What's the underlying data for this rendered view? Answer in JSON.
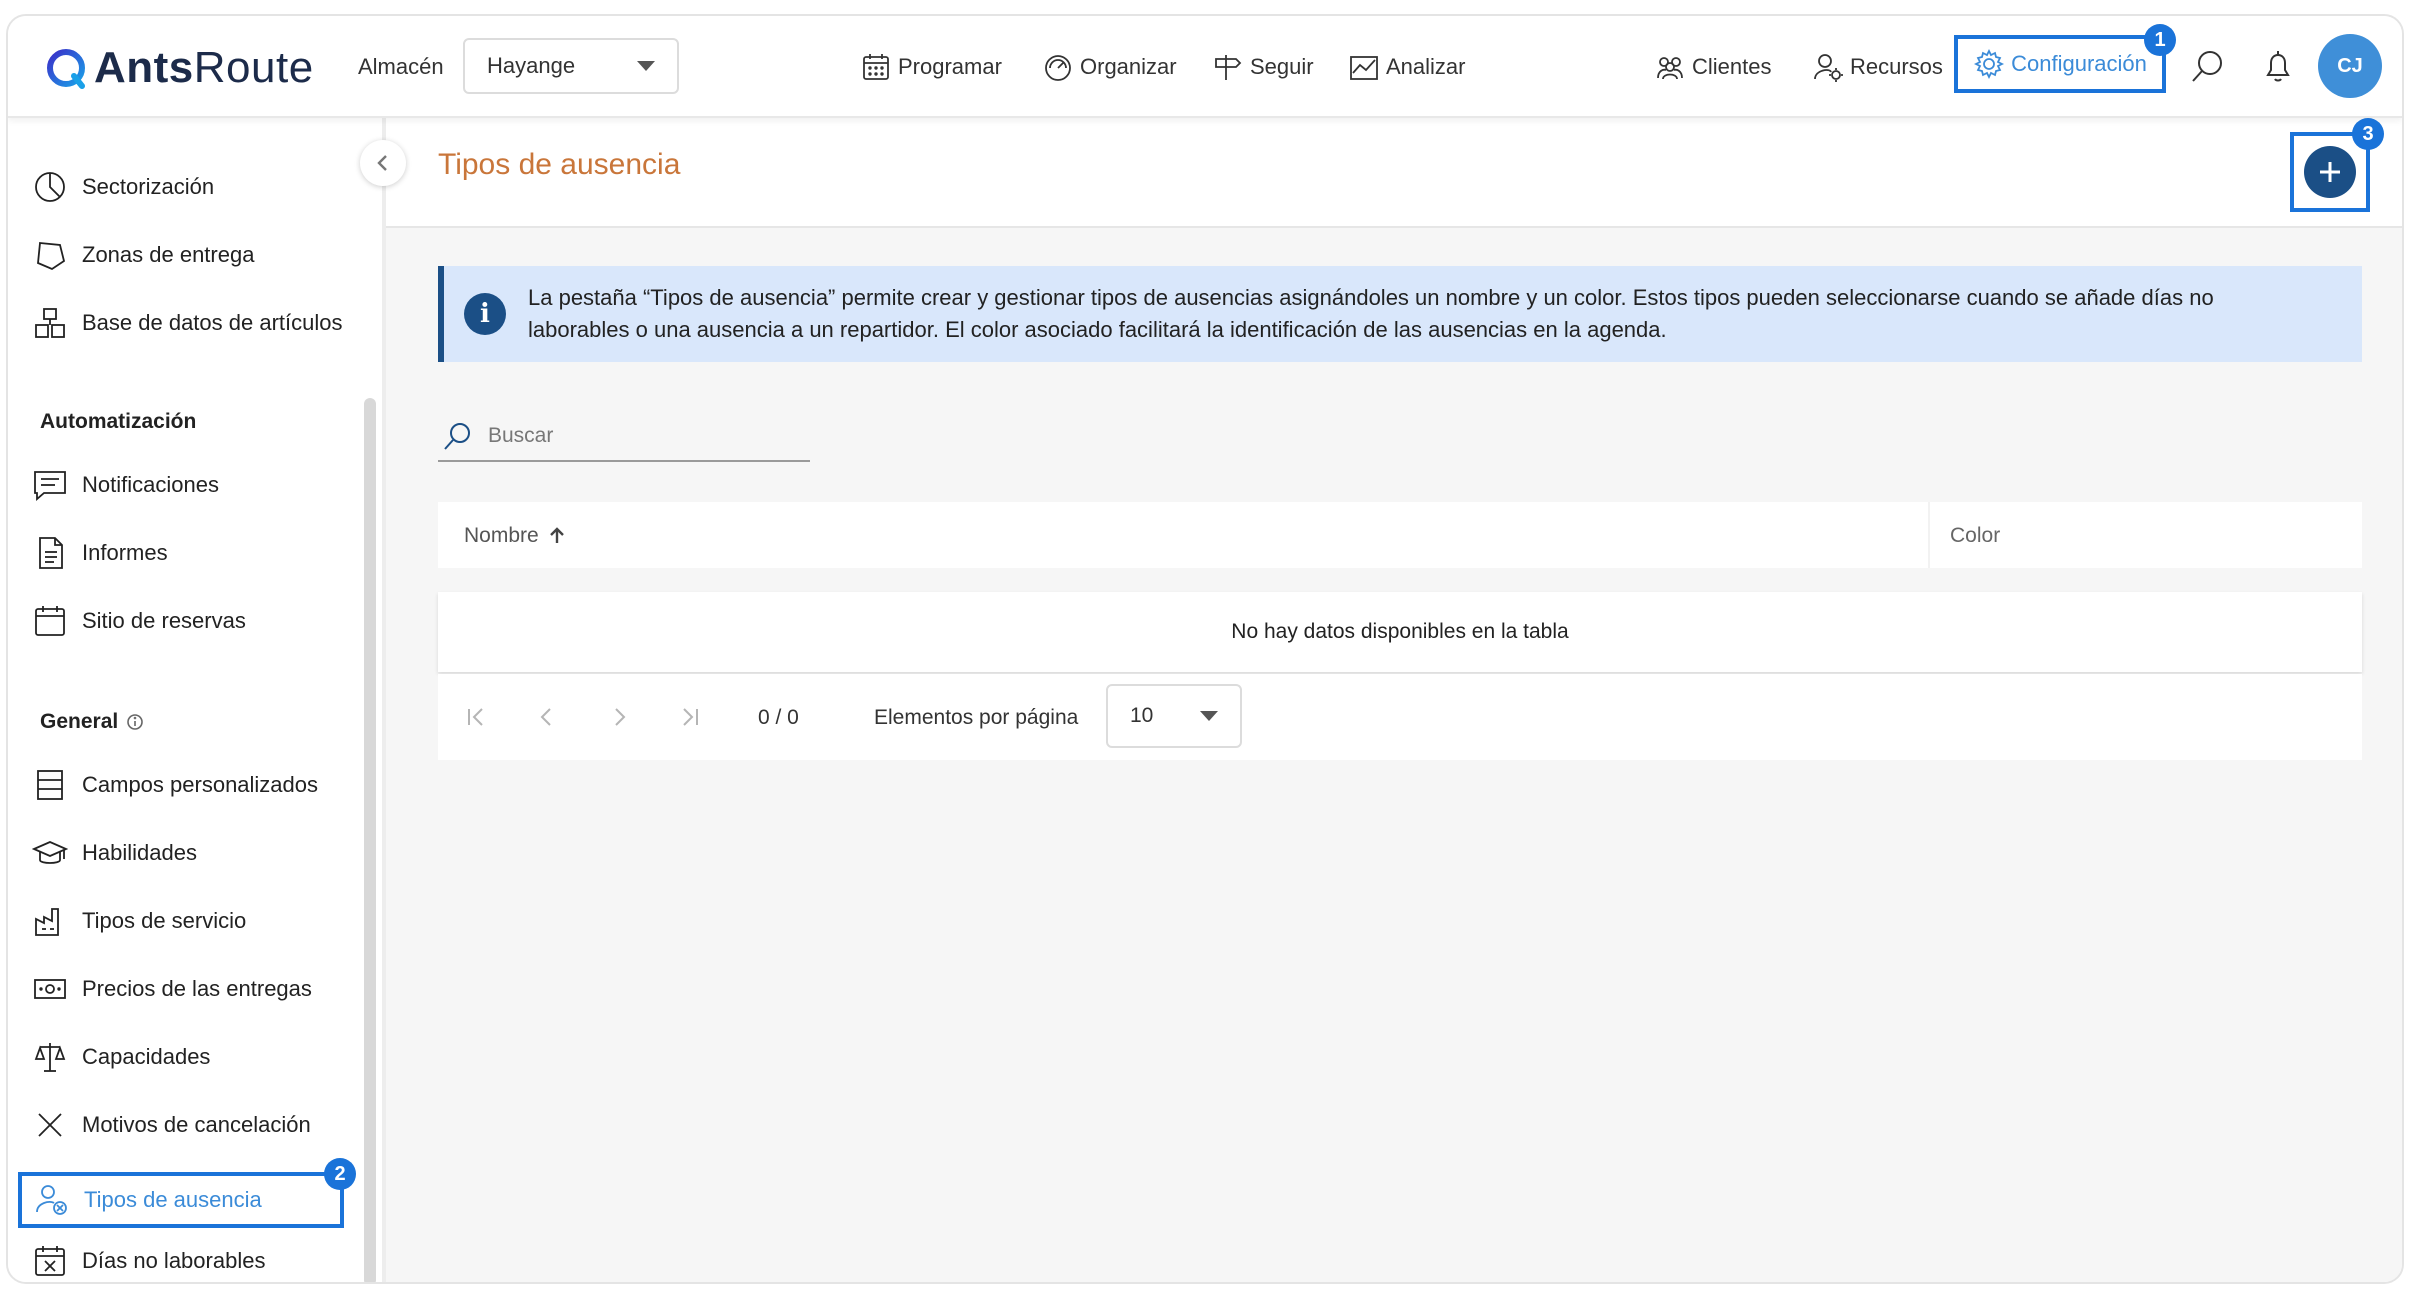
{
  "header": {
    "brand_bold": "Ants",
    "brand_regular": "Route",
    "store_label": "Almacén",
    "store_value": "Hayange",
    "nav": {
      "programar": "Programar",
      "organizar": "Organizar",
      "seguir": "Seguir",
      "analizar": "Analizar",
      "clientes": "Clientes",
      "recursos": "Recursos",
      "configuracion": "Configuración"
    },
    "avatar_initials": "CJ"
  },
  "badges": {
    "one": "1",
    "two": "2",
    "three": "3"
  },
  "sidebar": {
    "items_top": [
      "Sectorización",
      "Zonas de entrega",
      "Base de datos de artículos"
    ],
    "section_automation": "Automatización",
    "items_automation": [
      "Notificaciones",
      "Informes",
      "Sitio de reservas"
    ],
    "section_general": "General",
    "items_general": [
      "Campos personalizados",
      "Habilidades",
      "Tipos de servicio",
      "Precios de las entregas",
      "Capacidades",
      "Motivos de cancelación"
    ],
    "active_item": "Tipos de ausencia",
    "item_after": "Días no laborables"
  },
  "main": {
    "title": "Tipos de ausencia",
    "info_icon": "i",
    "info_text_line1": "La pestaña “Tipos de ausencia” permite crear y gestionar tipos de ausencias asignándoles un nombre y un color. Estos tipos pueden seleccionarse cuando se añade días no",
    "info_text_line2": "laborables o una ausencia a un repartidor. El color asociado facilitará la identificación de las ausencias en la agenda.",
    "search_placeholder": "Buscar",
    "table": {
      "col_name": "Nombre",
      "col_color": "Color",
      "empty_text": "No hay datos disponibles en la tabla"
    },
    "pager": {
      "count": "0 / 0",
      "per_page_label": "Elementos por página",
      "per_page_value": "10"
    }
  },
  "colors": {
    "accent_blue": "#1a73d9",
    "title_orange": "#c9763a",
    "navy": "#1b4f86",
    "info_bg": "#d9e7fb"
  }
}
